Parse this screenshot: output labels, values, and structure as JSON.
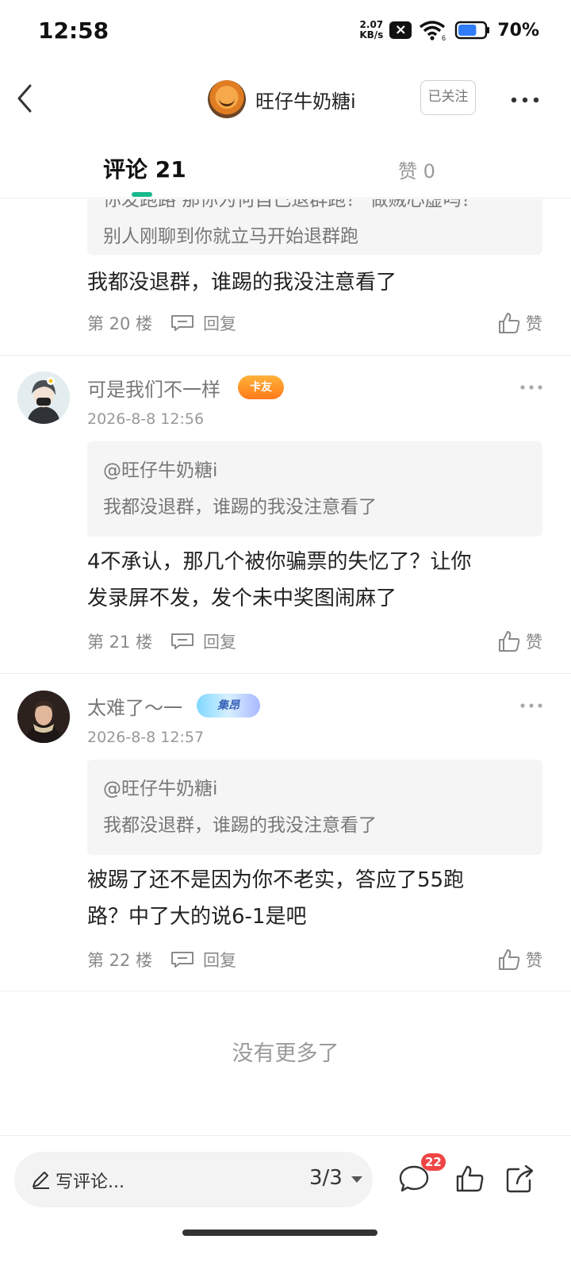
{
  "status_bar": {
    "time": "12:58",
    "net_speed_value": "2.07",
    "net_speed_unit": "KB/s",
    "wifi_label": "6",
    "battery_pct": "70%",
    "battery_level": 0.7
  },
  "header": {
    "author_name": "旺仔牛奶糖i",
    "follow_label": "已关注"
  },
  "tabs": {
    "comments_label": "评论 21",
    "likes_label": "赞 0"
  },
  "thread": [
    {
      "quote_text_1": "你发跑路 那你为何自己退群跑？ 做贼心虚吗？",
      "quote_text_2": "别人刚聊到你就立马开始退群跑",
      "text": "我都没退群，谁踢的我没注意看了",
      "floor": "第 20 楼",
      "reply_label": "回复",
      "like_label": "赞"
    },
    {
      "username": "可是我们不一样",
      "badge": "卡友",
      "timestamp": "2026-8-8 12:56",
      "quote_author": "@旺仔牛奶糖i",
      "quote_text": "我都没退群，谁踢的我没注意看了",
      "text_line_1": "4不承认，那几个被你骗票的失忆了？让你",
      "text_line_2": "发录屏不发，发个未中奖图闹麻了",
      "floor": "第 21 楼",
      "reply_label": "回复",
      "like_label": "赞"
    },
    {
      "username": "太难了～一",
      "badge": "集昂",
      "timestamp": "2026-8-8 12:57",
      "quote_author": "@旺仔牛奶糖i",
      "quote_text": "我都没退群，谁踢的我没注意看了",
      "text_line_1": "被踢了还不是因为你不老实，答应了55跑",
      "text_line_2": "路？中了大的说6-1是吧",
      "floor": "第 22 楼",
      "reply_label": "回复",
      "like_label": "赞"
    }
  ],
  "footer_note": "没有更多了",
  "bottom_bar": {
    "input_placeholder": "写评论...",
    "page_indicator": "3/3",
    "comment_count": "22"
  },
  "colors": {
    "accent": "#19b88e",
    "badge_red": "#f04545",
    "text_primary": "#222222",
    "text_muted": "#999999"
  },
  "icons": [
    "back-arrow-icon",
    "more-dots-icon",
    "reply-bubble-icon",
    "thumbs-up-icon",
    "pencil-icon",
    "caret-down-icon",
    "comment-bubble-icon",
    "share-icon"
  ]
}
